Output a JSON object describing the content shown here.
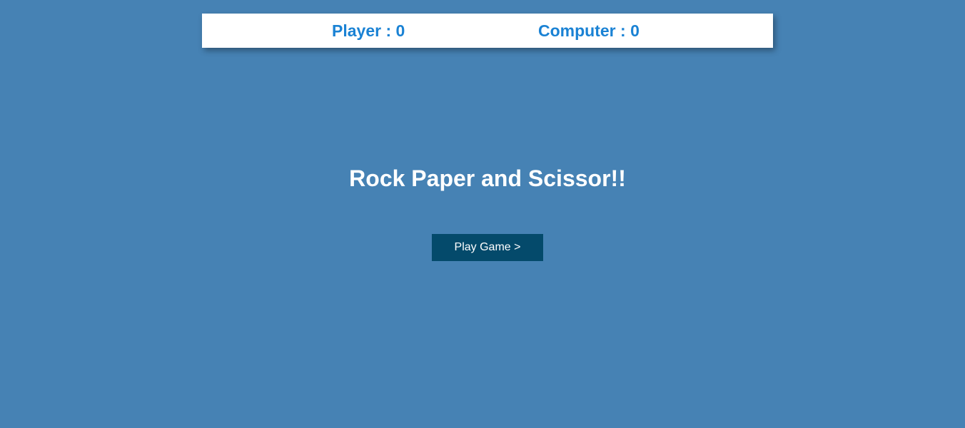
{
  "scoreboard": {
    "player_label": "Player",
    "player_score": "0",
    "computer_label": "Computer",
    "computer_score": "0",
    "separator": " : "
  },
  "intro": {
    "title": "Rock Paper and Scissor!!",
    "play_button_label": "Play Game >"
  },
  "colors": {
    "background": "#4682b4",
    "score_text": "#1a82d4",
    "button_background": "#044a6b",
    "title_text": "#ffffff"
  }
}
